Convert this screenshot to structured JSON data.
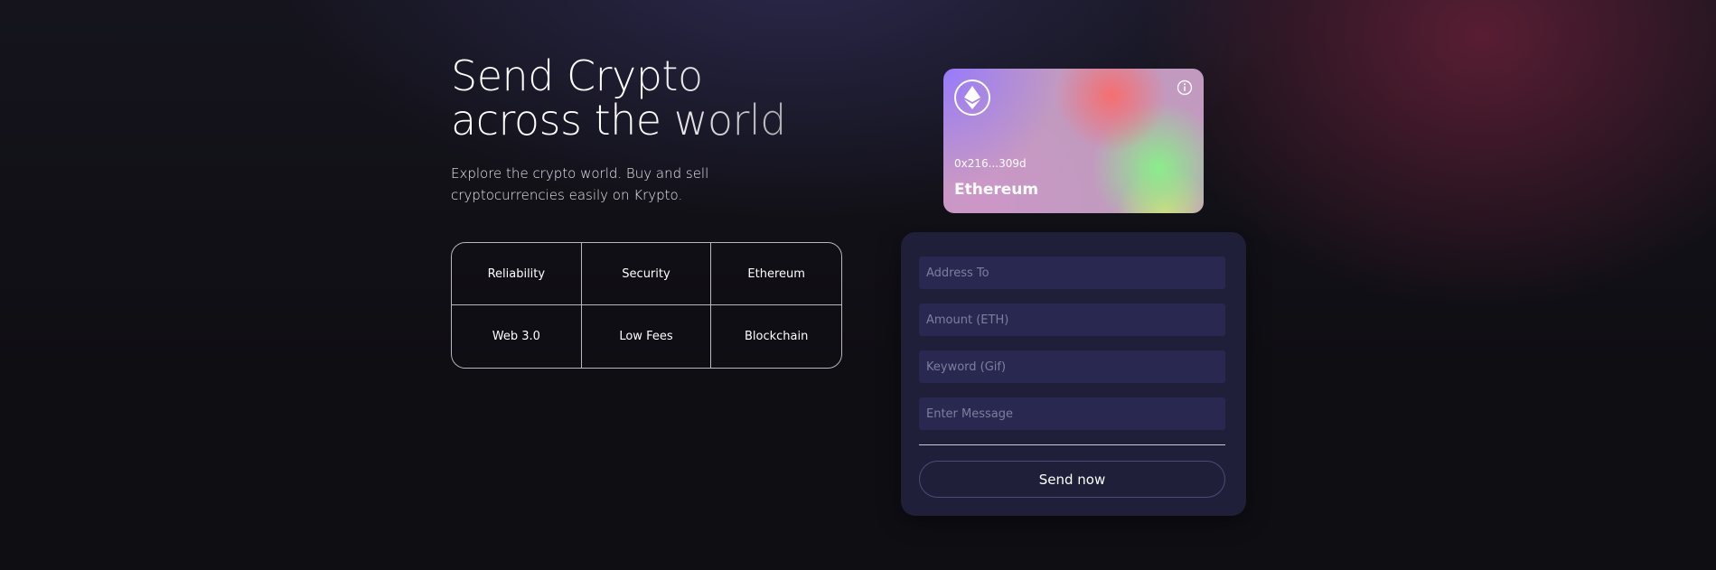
{
  "hero": {
    "headline_line1": "Send Crypto",
    "headline_line2": "across the world",
    "subtitle": "Explore the crypto world. Buy and sell cryptocurrencies easily on Krypto."
  },
  "features": [
    "Reliability",
    "Security",
    "Ethereum",
    "Web 3.0",
    "Low Fees",
    "Blockchain"
  ],
  "eth_card": {
    "logo_icon": "ethereum-icon",
    "info_icon": "info-icon",
    "address": "0x216...309d",
    "network": "Ethereum"
  },
  "form": {
    "address_placeholder": "Address To",
    "amount_placeholder": "Amount (ETH)",
    "keyword_placeholder": "Keyword (Gif)",
    "message_placeholder": "Enter Message",
    "send_label": "Send now"
  },
  "colors": {
    "background": "#0f0e13",
    "form_card": "#1f1f3a",
    "input_bg": "#282850",
    "button_border": "#4b4b7a"
  }
}
